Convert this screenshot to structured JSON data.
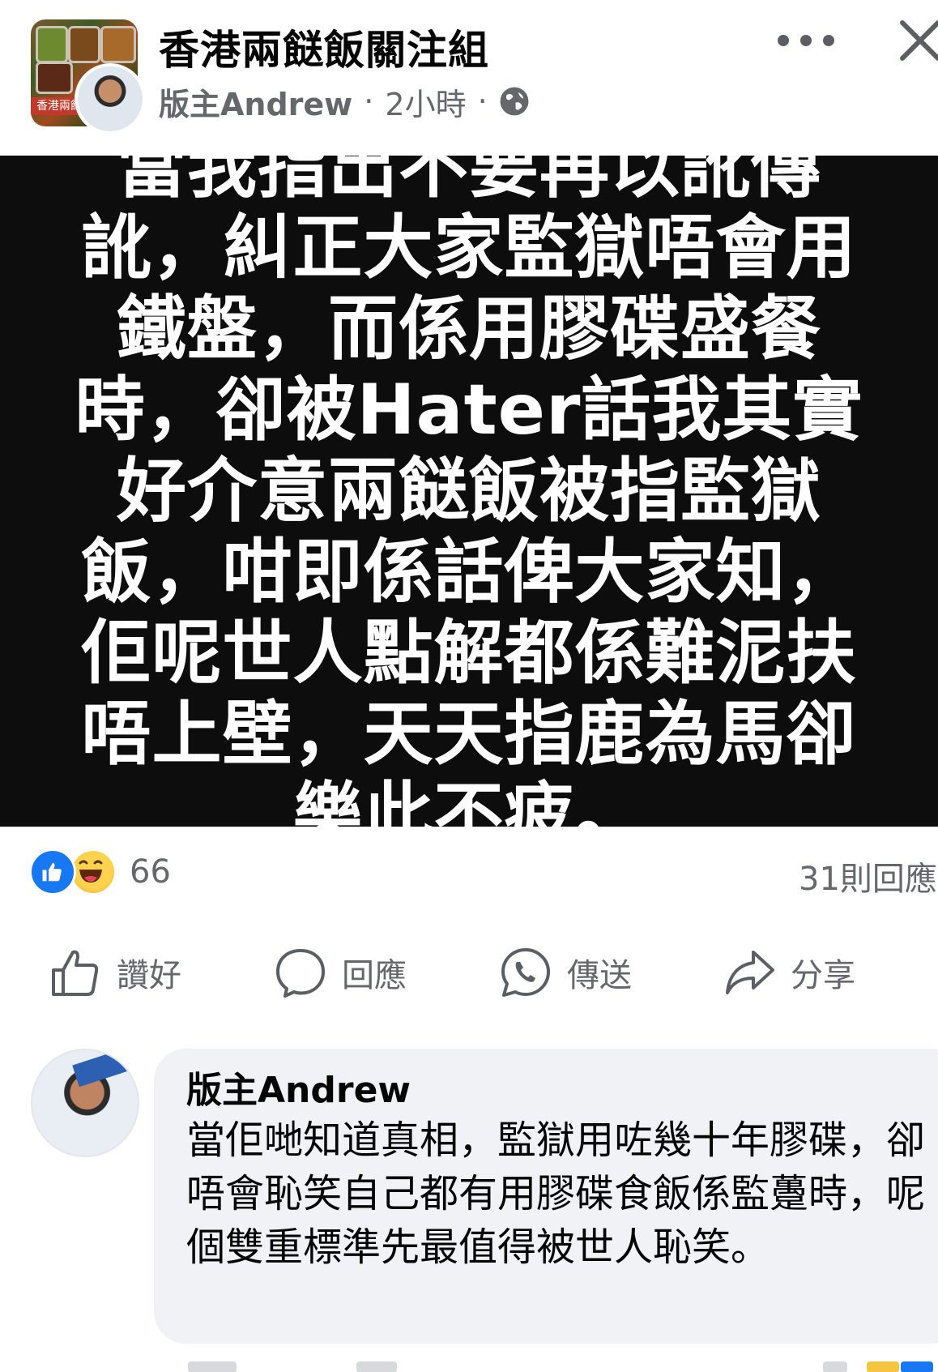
{
  "header": {
    "group_name": "香港兩餸飯關注組",
    "author": "版主Andrew",
    "separator": "·",
    "time": "2小時",
    "privacy_icon": "globe-icon",
    "more_icon": "more-icon",
    "close_icon": "close-icon"
  },
  "post": {
    "text": "當我指出不要再以訛傳訛，糾正大家監獄唔會用鐵盤，而係用膠碟盛餐時，卻被Hater話我其實好介意兩餸飯被指監獄飯，咁即係話俾大家知，佢呢世人點解都係難泥扶唔上壁，天天指鹿為馬卻樂此不疲。",
    "background_color": "#0d0d0d",
    "text_color": "#ffffff"
  },
  "reactions": {
    "icons": [
      "like-reaction-icon",
      "haha-reaction-icon"
    ],
    "count": "66",
    "comments": "31則回應"
  },
  "actions": [
    {
      "label": "讚好",
      "icon": "thumbs-up-icon"
    },
    {
      "label": "回應",
      "icon": "comment-bubble-icon"
    },
    {
      "label": "傳送",
      "icon": "whatsapp-icon"
    },
    {
      "label": "分享",
      "icon": "share-arrow-icon"
    }
  ],
  "comment": {
    "author": "版主Andrew",
    "text": "當佢哋知道真相，監獄用咗幾十年膠碟，卻唔會恥笑自己都有用膠碟食飯係監躉時，呢個雙重標準先最值得被世人恥笑。",
    "bubble_color": "#f0f2f5"
  },
  "colors": {
    "accent": "#1877f2",
    "secondary_text": "#65676b",
    "icon_gray": "#5b5e63"
  }
}
